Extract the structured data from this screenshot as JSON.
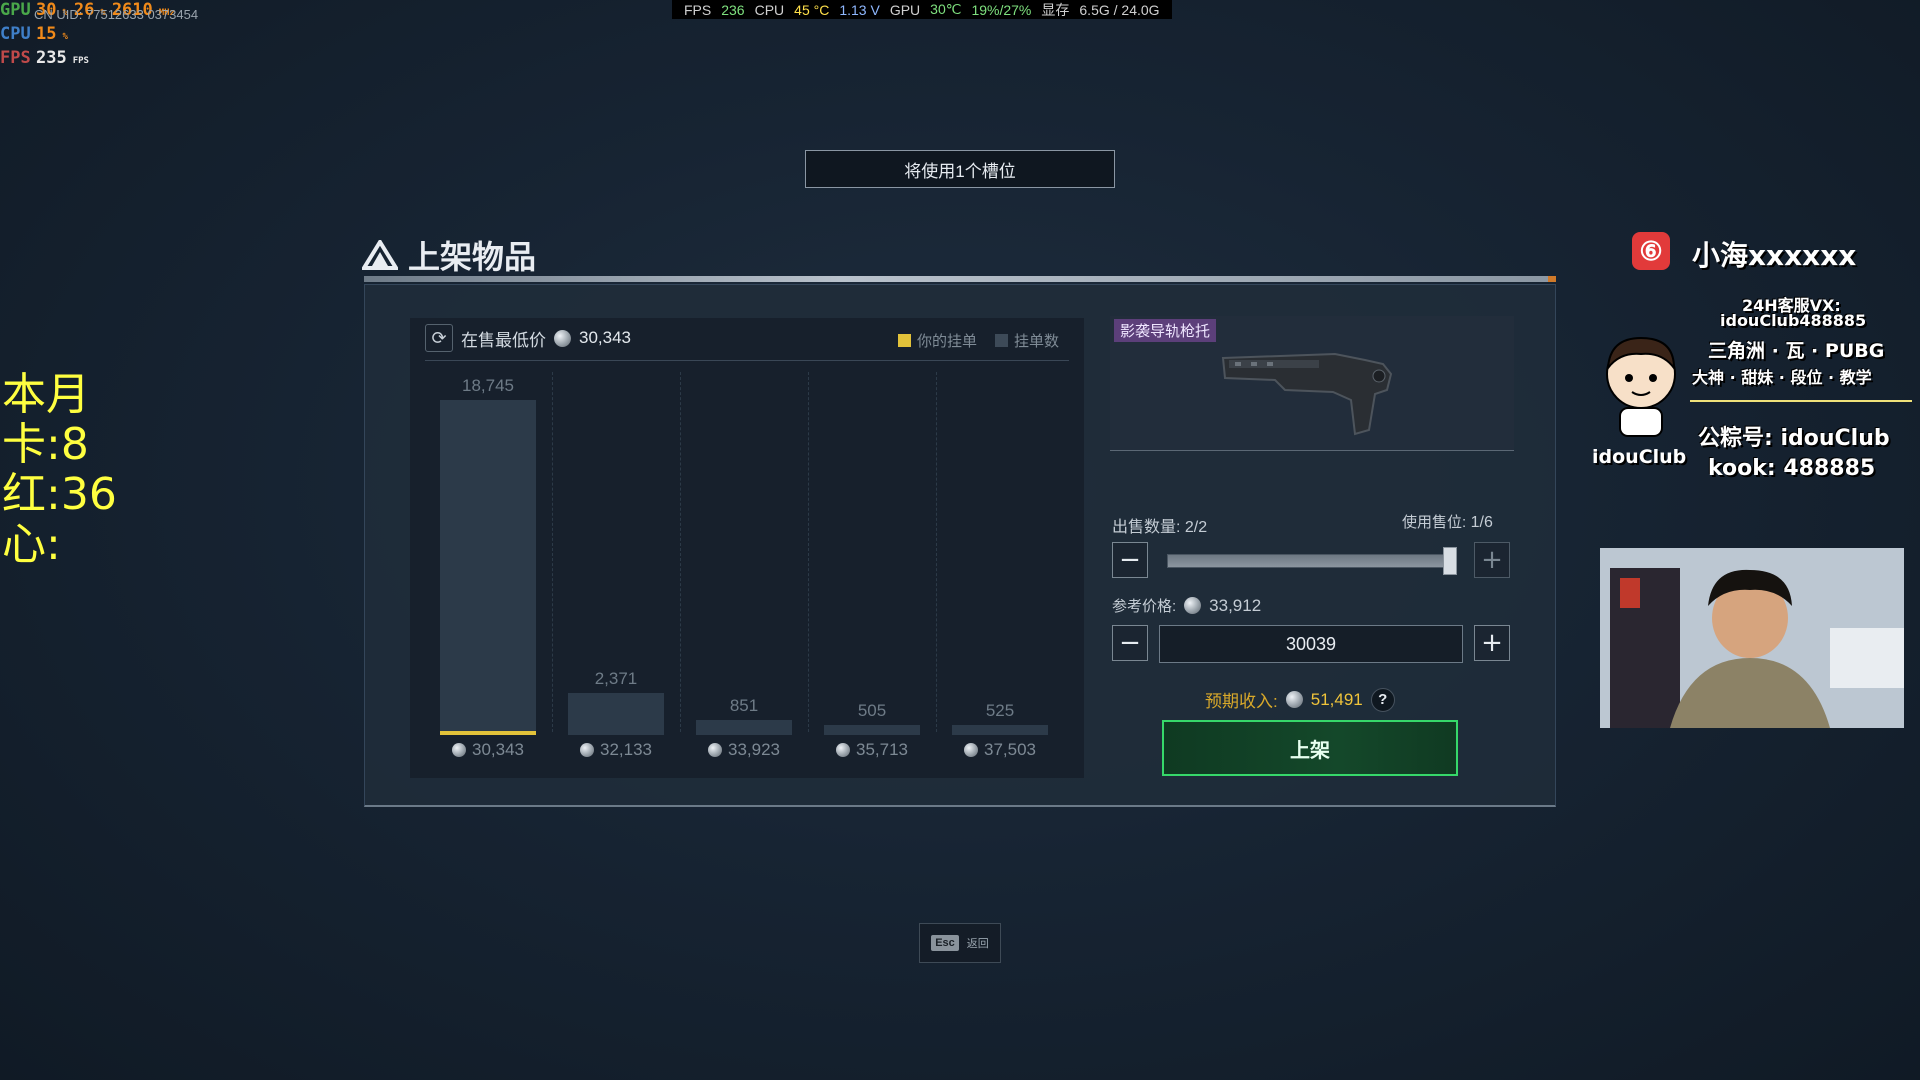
{
  "osd": {
    "gpu_label": "GPU",
    "gpu_val1": "30",
    "gpu_unit1": "%",
    "gpu_val2": "26",
    "gpu_unit2": "%",
    "gpu_clock": "2610",
    "gpu_clock_unit": "MHz",
    "uid_text": "CN UID: 77512633 0373454",
    "cpu_label": "CPU",
    "cpu_val": "15",
    "cpu_unit": "%",
    "fps_label": "FPS",
    "fps_val": "235",
    "fps_unit": "FPS"
  },
  "monitor_bar": {
    "fps_label": "FPS",
    "fps": "236",
    "cpu_label": "CPU",
    "cpu_temp": "45 °C",
    "cpu_volt": "1.13 V",
    "gpu_label": "GPU",
    "gpu_temp": "30℃",
    "gpu_load": "19%/27%",
    "vram_label": "显存",
    "vram": "6.5G / 24.0G"
  },
  "slot_notice": "将使用1个槽位",
  "stream_stats": [
    "本月",
    "卡:8",
    "红:36",
    "心:"
  ],
  "panel": {
    "title": "上架物品",
    "lowest_label": "在售最低价",
    "lowest_price": "30,343",
    "legend_mine": "你的挂单",
    "legend_count": "挂单数"
  },
  "chart_data": {
    "type": "bar",
    "categories": [
      "30,343",
      "32,133",
      "33,923",
      "35,713",
      "37,503"
    ],
    "values": [
      18745,
      2371,
      851,
      505,
      525
    ],
    "value_labels": [
      "18,745",
      "2,371",
      "851",
      "505",
      "525"
    ],
    "mine_index": 0,
    "ylim": [
      0,
      18745
    ]
  },
  "item": {
    "name": "影袭导轨枪托"
  },
  "sell": {
    "qty_label": "出售数量:",
    "qty_value": "2/2",
    "slot_label": "使用售位:",
    "slot_value": "1/6",
    "qty_fraction": 1.0,
    "ref_label": "参考价格:",
    "ref_price": "33,912",
    "price_input": "30039",
    "income_label": "预期收入:",
    "income_value": "51,491",
    "help": "?",
    "list_button": "上架",
    "minus": "−",
    "plus": "+"
  },
  "esc": {
    "key": "Esc",
    "label": "返回"
  },
  "streamer": {
    "name": "小海xxxxxx",
    "logo_glyph": "⑥",
    "line1": "24H客服VX:",
    "line2": "idouClub488885",
    "line3": "三角洲 · 瓦 · PUBG",
    "line4": "大神 · 甜妹 · 段位 · 教学",
    "line5": "公粽号: idouClub",
    "line6": "kook: 488885",
    "club": "idouClub"
  },
  "colors": {
    "mine_bar": "#e2c23a",
    "count_bar": "#2c3a49",
    "list_button_border": "#36d86a",
    "income": "#f0c43a"
  }
}
